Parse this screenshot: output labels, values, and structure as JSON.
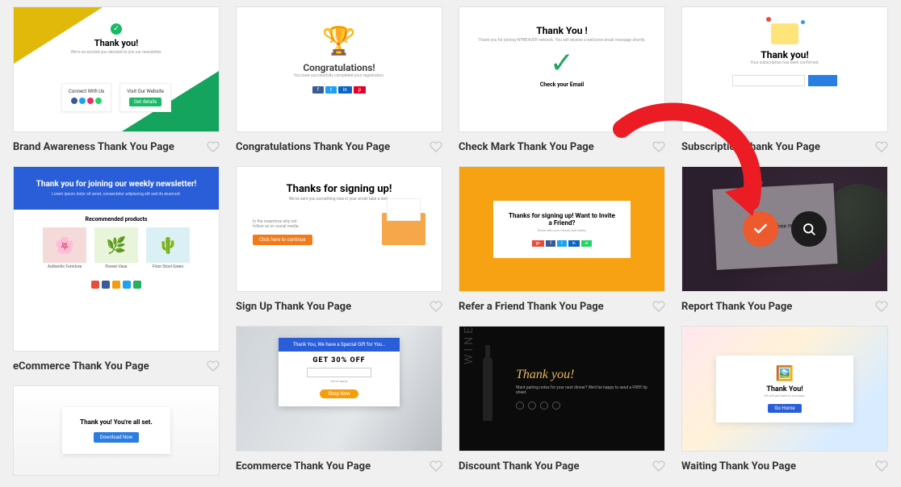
{
  "templates": {
    "brand_awareness": {
      "title": "Brand Awareness Thank You Page",
      "preview": {
        "heading": "Thank you!",
        "connect_label": "Connect With Us",
        "visit_label": "Visit Our Website",
        "visit_btn": "Get details"
      }
    },
    "congratulations": {
      "title": "Congratulations Thank You Page",
      "preview": {
        "heading": "Congratulations!"
      }
    },
    "check_mark": {
      "title": "Check Mark Thank You Page",
      "preview": {
        "heading": "Thank You !",
        "label": "Check your Email"
      }
    },
    "subscription": {
      "title": "Subscription Thank You Page",
      "preview": {
        "heading": "Thank you!"
      }
    },
    "ecommerce": {
      "title": "eCommerce Thank You Page",
      "preview": {
        "heading": "Thank you for joining our weekly newsletter!",
        "section": "Recommended products",
        "items": [
          "Authentic Furniture",
          "Flower Vase",
          "Floor Stool Green"
        ]
      }
    },
    "sign_up": {
      "title": "Sign Up Thank You Page",
      "preview": {
        "heading": "Thanks for signing up!",
        "button": "Click here to continue"
      }
    },
    "ecommerce_2": {
      "title": "Ecommerce Thank You Page",
      "preview": {
        "banner": "Thank You, We have a Special Gift for You…",
        "offer": "GET 30% OFF",
        "button": "Shop Now"
      }
    },
    "refer": {
      "title": "Refer a Friend Thank You Page",
      "preview": {
        "heading": "Thanks for signing up! Want to Invite a Friend?"
      }
    },
    "discount": {
      "title": "Discount Thank You Page",
      "preview": {
        "heading": "Thank you!",
        "side": "WINE"
      }
    },
    "report": {
      "title": "Report Thank You Page",
      "preview": {
        "heading": "Here's your free report"
      }
    },
    "waiting": {
      "title": "Waiting Thank You Page",
      "preview": {
        "heading": "Thank You!",
        "button": "Go Home"
      }
    },
    "allset": {
      "preview": {
        "heading": "Thank you! You're all set.",
        "button": "Download Now"
      }
    }
  }
}
